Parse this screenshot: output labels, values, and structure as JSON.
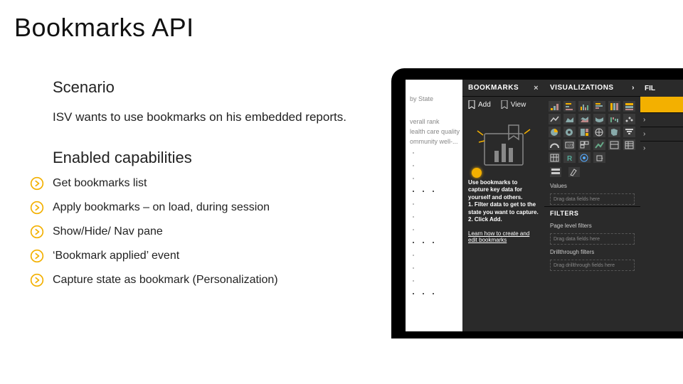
{
  "title": "Bookmarks API",
  "scenario": {
    "heading": "Scenario",
    "text": "ISV wants to use bookmarks on his embedded reports."
  },
  "capabilities": {
    "heading": "Enabled capabilities",
    "items": [
      "Get bookmarks list",
      "Apply bookmarks – on load, during session",
      "Show/Hide/ Nav pane",
      "‘Bookmark applied’ event",
      "Capture state as bookmark (Personalization)"
    ]
  },
  "laptop": {
    "report_lines": [
      "by State",
      "verall rank",
      "lealth care quality",
      "ommunity well-..."
    ],
    "bookmarks_panel": {
      "title": "BOOKMARKS",
      "close": "×",
      "add": "Add",
      "view": "View",
      "tip_intro": "Use bookmarks to capture key data for yourself and others.",
      "tip_step1": "1. Filter data to get to the state you want to capture.",
      "tip_step2": "2. Click Add.",
      "link": "Learn how to create and edit bookmarks"
    },
    "viz_panel": {
      "title": "VISUALIZATIONS",
      "chevron": "›",
      "values_label": "Values",
      "drop_text": "Drag data fields here",
      "filters_title": "FILTERS",
      "filter_rows": [
        "Page level filters",
        "Drag data fields here",
        "Drillthrough filters",
        "Drag drillthrough fields here"
      ]
    },
    "fil_panel": {
      "title": "FIL"
    }
  }
}
